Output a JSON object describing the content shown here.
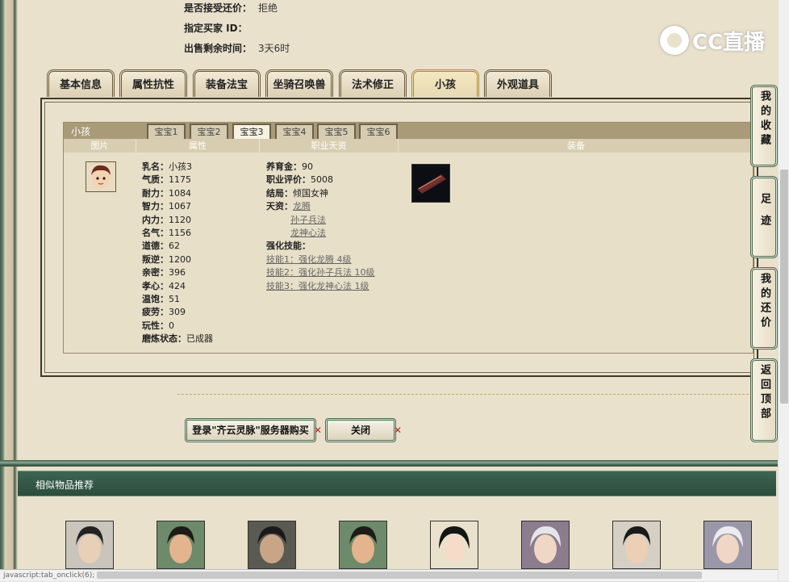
{
  "top_info": [
    {
      "label": "是否接受还价：",
      "value": "拒绝"
    },
    {
      "label": "指定买家 ID：",
      "value": ""
    },
    {
      "label": "出售剩余时间：",
      "value": "3天6时"
    }
  ],
  "logo_text": "CC直播",
  "main_tabs": [
    "基本信息",
    "属性抗性",
    "装备法宝",
    "坐骑召唤兽",
    "法术修正",
    "小孩",
    "外观道具"
  ],
  "active_main_tab": "小孩",
  "section_title": "小孩",
  "sub_tabs": [
    "宝宝1",
    "宝宝2",
    "宝宝3",
    "宝宝4",
    "宝宝5",
    "宝宝6"
  ],
  "active_sub_tab": "宝宝3",
  "columns": [
    "图片",
    "属性",
    "职业天资",
    "装备"
  ],
  "attributes": [
    {
      "k": "乳名：",
      "v": "小孩3"
    },
    {
      "k": "气质：",
      "v": "1175"
    },
    {
      "k": "耐力：",
      "v": "1084"
    },
    {
      "k": "智力：",
      "v": "1067"
    },
    {
      "k": "内力：",
      "v": "1120"
    },
    {
      "k": "名气：",
      "v": "1156"
    },
    {
      "k": "道德：",
      "v": "62"
    },
    {
      "k": "叛逆：",
      "v": "1200"
    },
    {
      "k": "亲密：",
      "v": "396"
    },
    {
      "k": "孝心：",
      "v": "424"
    },
    {
      "k": "温饱：",
      "v": "51"
    },
    {
      "k": "疲劳：",
      "v": "309"
    },
    {
      "k": "玩性：",
      "v": "0"
    },
    {
      "k": "磨炼状态：",
      "v": "已成器"
    }
  ],
  "job": {
    "fees_label": "养育金：",
    "fees": "90",
    "rating_label": "职业评价：",
    "rating": "5008",
    "ending_label": "结局：",
    "ending": "倾国女神",
    "talent_label": "天资：",
    "talents": [
      "龙腾",
      "孙子兵法",
      "龙神心法"
    ],
    "skills_label": "强化技能：",
    "skills": [
      "技能1：强化龙腾 4级",
      "技能2：强化孙子兵法 10级",
      "技能3：强化龙神心法 1级"
    ]
  },
  "buttons": {
    "buy": "登录\"齐云灵脉\"服务器购买",
    "close": "关闭"
  },
  "recommend_title": "相似物品推荐",
  "side_buttons": [
    "我的收藏",
    "足迹",
    "我的还价",
    "返回顶部"
  ],
  "status_text": "javascript:tab_onclick(6);"
}
